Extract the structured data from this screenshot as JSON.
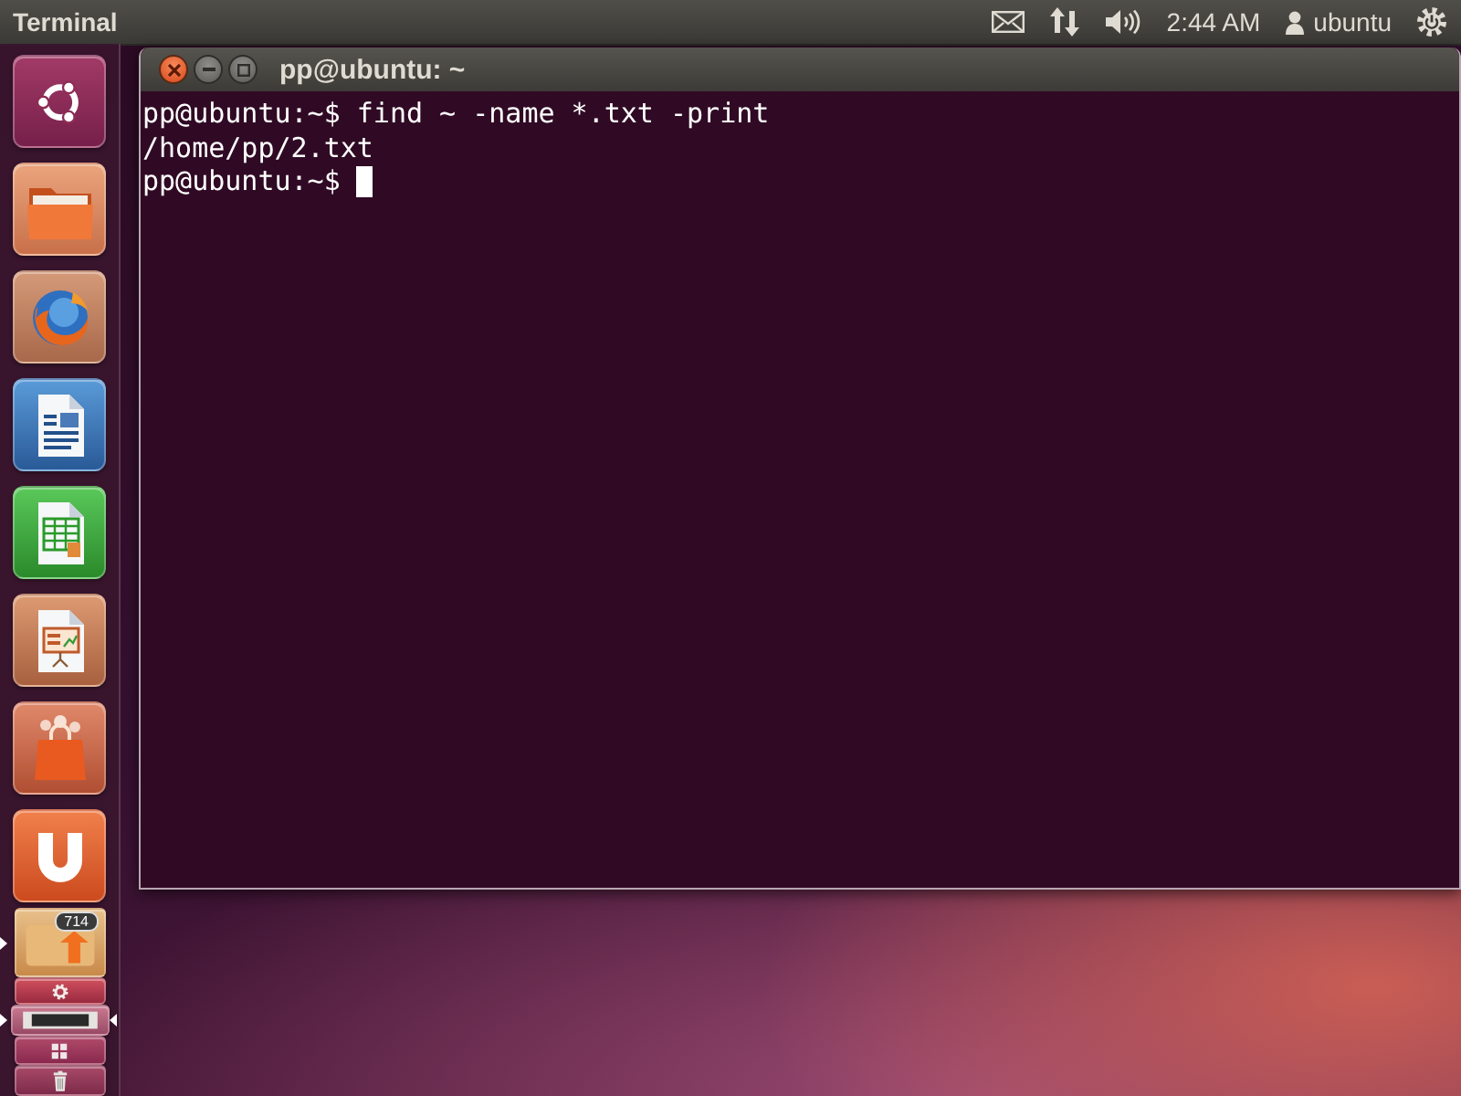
{
  "top_panel": {
    "app_title": "Terminal",
    "clock": "2:44 AM",
    "user": "ubuntu"
  },
  "launcher": {
    "items": [
      {
        "kind": "dash",
        "running": false,
        "focused": false
      },
      {
        "kind": "files",
        "running": false,
        "focused": false
      },
      {
        "kind": "browser",
        "running": false,
        "focused": false
      },
      {
        "kind": "writer",
        "running": false,
        "focused": false
      },
      {
        "kind": "calc",
        "running": false,
        "focused": false
      },
      {
        "kind": "impress",
        "running": false,
        "focused": false
      },
      {
        "kind": "store",
        "running": false,
        "focused": false
      },
      {
        "kind": "cloud",
        "running": false,
        "focused": false
      }
    ],
    "folded_items": [
      {
        "kind": "updates",
        "badge": "714",
        "running": true,
        "focused": false
      },
      {
        "kind": "settings",
        "running": false,
        "focused": false
      },
      {
        "kind": "terminal",
        "running": true,
        "focused": true
      },
      {
        "kind": "workspaces",
        "running": false,
        "focused": false
      },
      {
        "kind": "trash",
        "running": false,
        "focused": false
      }
    ]
  },
  "terminal": {
    "title": "pp@ubuntu: ~",
    "lines": [
      "pp@ubuntu:~$ find ~ -name *.txt -print",
      "/home/pp/2.txt",
      "pp@ubuntu:~$"
    ],
    "cursor": true
  }
}
